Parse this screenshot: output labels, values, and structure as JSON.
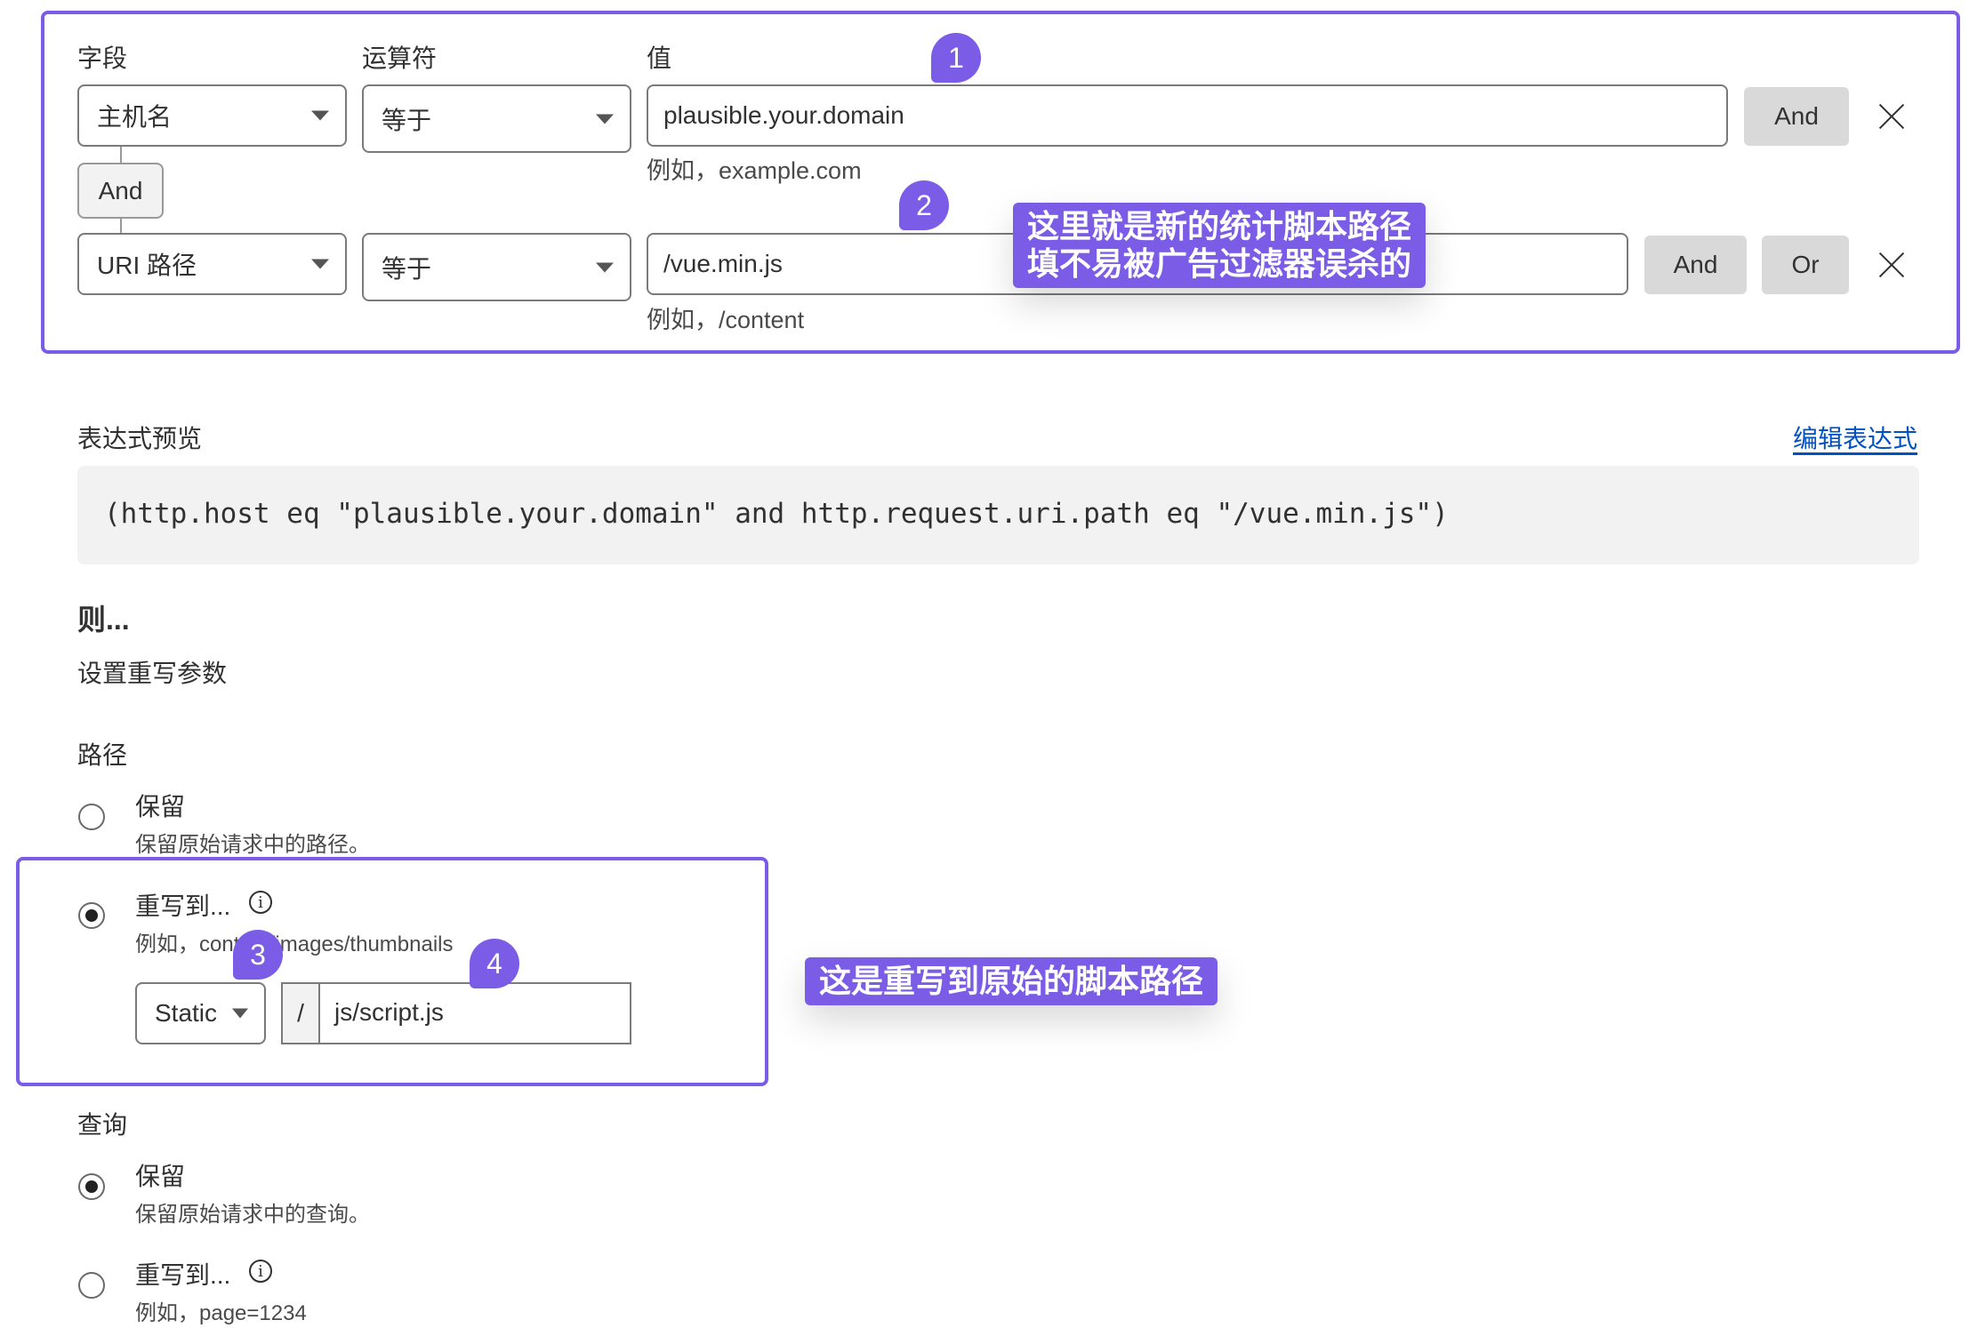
{
  "conditions": {
    "headers": {
      "field": "字段",
      "operator": "运算符",
      "value": "值"
    },
    "rows": [
      {
        "field": "主机名",
        "operator": "等于",
        "value": "plausible.your.domain",
        "hint": "例如，example.com",
        "buttons": [
          "And"
        ]
      },
      {
        "field": "URI 路径",
        "operator": "等于",
        "value": "/vue.min.js",
        "hint": "例如，/content",
        "buttons": [
          "And",
          "Or"
        ]
      }
    ],
    "connector": "And"
  },
  "annotations": {
    "bubbles": [
      "1",
      "2",
      "3",
      "4"
    ],
    "callout_1": [
      "这里就是新的统计脚本路径",
      "填不易被广告过滤器误杀的"
    ],
    "callout_2": "这是重写到原始的脚本路径"
  },
  "preview": {
    "title": "表达式预览",
    "edit_link": "编辑表达式",
    "expression": "(http.host eq \"plausible.your.domain\" and http.request.uri.path eq \"/vue.min.js\")"
  },
  "then": {
    "heading": "则...",
    "subheading": "设置重写参数"
  },
  "path": {
    "label": "路径",
    "preserve_label": "保留",
    "preserve_desc": "保留原始请求中的路径。",
    "rewrite_label": "重写到...",
    "rewrite_desc": "例如，content/images/thumbnails",
    "selected": "rewrite",
    "type_select": "Static",
    "prefix": "/",
    "rewrite_value": "js/script.js"
  },
  "query": {
    "label": "查询",
    "preserve_label": "保留",
    "preserve_desc": "保留原始请求中的查询。",
    "rewrite_label": "重写到...",
    "rewrite_desc": "例如，page=1234",
    "selected": "preserve"
  },
  "colors": {
    "accent": "#7b5ce6",
    "link": "#0051c3"
  }
}
